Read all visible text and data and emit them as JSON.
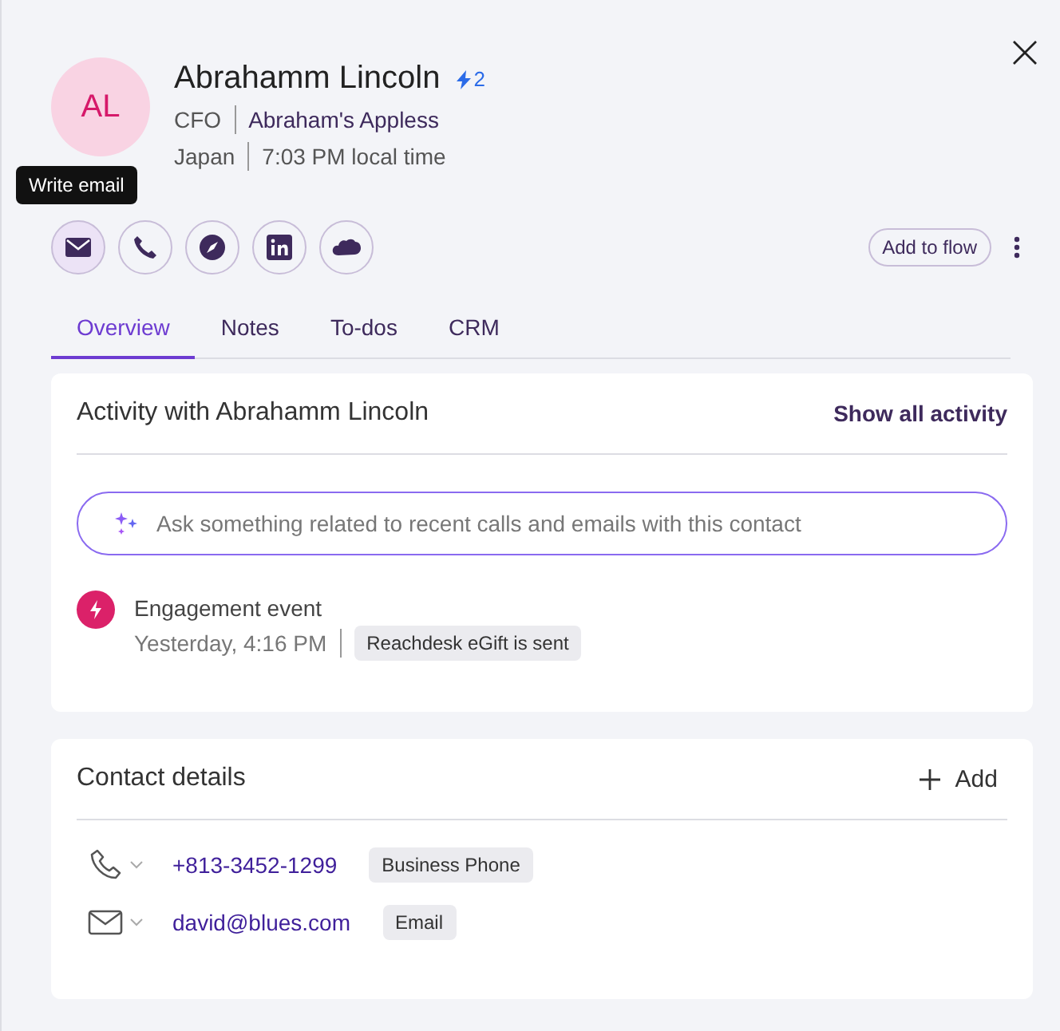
{
  "contact": {
    "initials": "AL",
    "name": "Abrahamm Lincoln",
    "badge_count": "2",
    "title": "CFO",
    "company": "Abraham's Appless",
    "country": "Japan",
    "local_time": "7:03 PM local time"
  },
  "tooltip": "Write email",
  "actions": [
    {
      "kind": "email",
      "selected": true
    },
    {
      "kind": "phone",
      "selected": false
    },
    {
      "kind": "compass",
      "selected": false
    },
    {
      "kind": "linkedin",
      "selected": false
    },
    {
      "kind": "cloud",
      "selected": false
    }
  ],
  "add_to_flow": "Add to flow",
  "tabs": [
    {
      "label": "Overview",
      "selected": true
    },
    {
      "label": "Notes",
      "selected": false
    },
    {
      "label": "To-dos",
      "selected": false
    },
    {
      "label": "CRM",
      "selected": false
    }
  ],
  "activity": {
    "title": "Activity with Abrahamm Lincoln",
    "show_all": "Show all activity",
    "ask_placeholder": "Ask something related to recent calls and emails with this contact",
    "events": [
      {
        "title": "Engagement event",
        "time": "Yesterday, 4:16 PM",
        "tag": "Reachdesk eGift is sent"
      }
    ]
  },
  "contact_details": {
    "title": "Contact details",
    "add": "Add",
    "items": [
      {
        "kind": "phone",
        "value": "+813-3452-1299",
        "label": "Business Phone"
      },
      {
        "kind": "email",
        "value": "david@blues.com",
        "label": "Email"
      }
    ]
  }
}
